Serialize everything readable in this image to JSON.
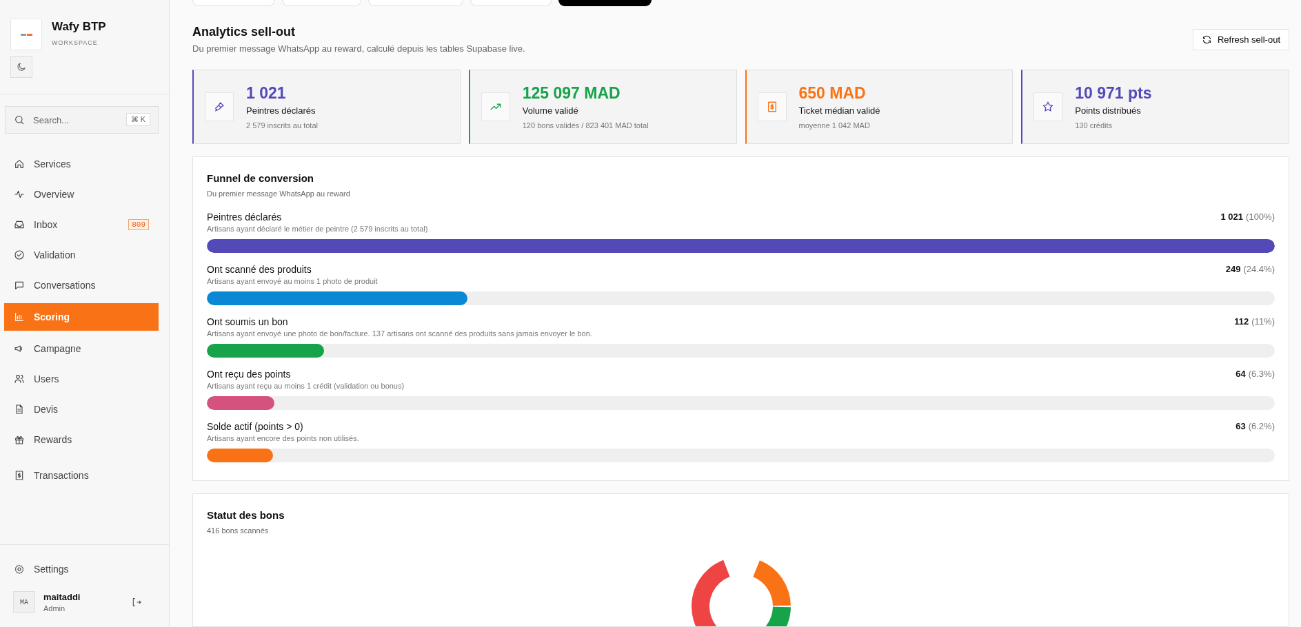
{
  "tabs": [
    {
      "selected": false
    },
    {
      "selected": false
    },
    {
      "selected": false
    },
    {
      "selected": false
    },
    {
      "selected": true
    }
  ],
  "sidebar": {
    "brand": {
      "name": "Wafy BTP",
      "subtitle": "WORKSPACE"
    },
    "search": {
      "placeholder": "Search...",
      "shortcut": "⌘ K"
    },
    "nav": [
      {
        "label": "Services",
        "selected": false
      },
      {
        "label": "Overview",
        "selected": false
      },
      {
        "label": "Inbox",
        "selected": false,
        "badge": "809"
      },
      {
        "label": "Validation",
        "selected": false
      },
      {
        "label": "Conversations",
        "selected": false
      },
      {
        "label": "Scoring",
        "selected": true
      },
      {
        "label": "Campagne",
        "selected": false
      },
      {
        "label": "Users",
        "selected": false
      },
      {
        "label": "Devis",
        "selected": false
      },
      {
        "label": "Rewards",
        "selected": false
      },
      {
        "label": "Transactions",
        "selected": false
      }
    ],
    "settings": "Settings",
    "user": {
      "initials": "MA",
      "name": "maitaddi",
      "role": "Admin"
    }
  },
  "header": {
    "title": "Analytics sell-out",
    "subtitle": "Du premier message WhatsApp au reward, calculé depuis les tables Supabase live.",
    "refresh_button": "Refresh sell-out"
  },
  "kpis": [
    {
      "value": "1 021",
      "label": "Peintres déclarés",
      "detail": "2 579 inscrits au total",
      "color": "#534ab7"
    },
    {
      "value": "125 097 MAD",
      "label": "Volume validé",
      "detail": "120 bons validés / 823 401 MAD total",
      "color": "#16a34a"
    },
    {
      "value": "650 MAD",
      "label": "Ticket médian validé",
      "detail": "moyenne 1 042 MAD",
      "color": "#f97316"
    },
    {
      "value": "10 971 pts",
      "label": "Points distribués",
      "detail": "130 crédits",
      "color": "#534ab7"
    }
  ],
  "funnel": {
    "title": "Funnel de conversion",
    "subtitle": "Du premier message WhatsApp au reward",
    "steps": [
      {
        "label": "Peintres déclarés",
        "description": "Artisans ayant déclaré le métier de peintre (2 579 inscrits au total)",
        "count": "1 021",
        "percent": "(100%)",
        "level": 1,
        "color": "#534ab7"
      },
      {
        "label": "Ont scanné des produits",
        "description": "Artisans ayant envoyé au moins 1 photo de produit",
        "count": "249",
        "percent": "(24.4%)",
        "level": 0.244,
        "color": "#0a88d4"
      },
      {
        "label": "Ont soumis un bon",
        "description": "Artisans ayant envoyé une photo de bon/facture. 137 artisans ont scanné des produits sans jamais envoyer le bon.",
        "count": "112",
        "percent": "(11%)",
        "level": 0.11,
        "color": "#16a34a"
      },
      {
        "label": "Ont reçu des points",
        "description": "Artisans ayant reçu au moins 1 crédit (validation ou bonus)",
        "count": "64",
        "percent": "(6.3%)",
        "level": 0.063,
        "color": "#d6527e"
      },
      {
        "label": "Solde actif (points > 0)",
        "description": "Artisans ayant encore des points non utilisés.",
        "count": "63",
        "percent": "(6.2%)",
        "level": 0.062,
        "color": "#f97316"
      }
    ]
  },
  "status": {
    "title": "Statut des bons",
    "subtitle": "416 bons scannés"
  }
}
